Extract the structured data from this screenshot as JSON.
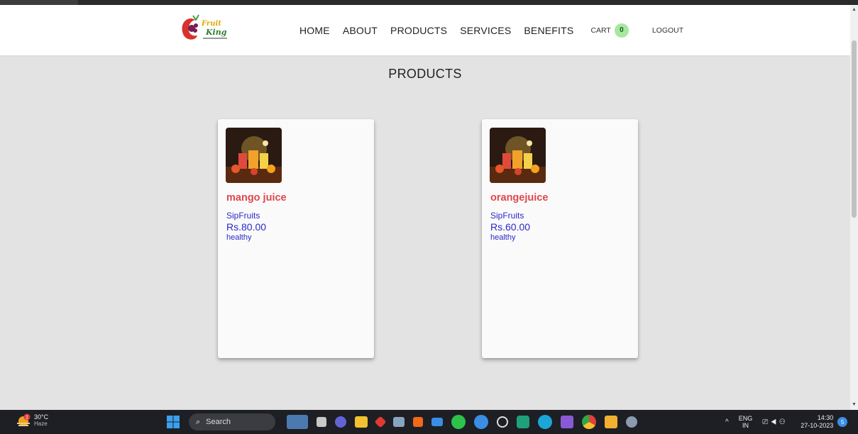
{
  "nav": {
    "logo_alt": "Fruit King",
    "links": [
      "HOME",
      "ABOUT",
      "PRODUCTS",
      "SERVICES",
      "BENEFITS"
    ],
    "cart_label": "CART",
    "cart_count": "0",
    "logout_label": "LOGOUT"
  },
  "page": {
    "title": "PRODUCTS"
  },
  "products": [
    {
      "name": "mango juice",
      "brand": "SipFruits",
      "price": "Rs.80.00",
      "tag": "healthy"
    },
    {
      "name": "orangejuice",
      "brand": "SipFruits",
      "price": "Rs.60.00",
      "tag": "healthy"
    }
  ],
  "taskbar": {
    "weather_temp": "30°C",
    "weather_cond": "Haze",
    "weather_badge": "1",
    "search_label": "Search",
    "lang_top": "ENG",
    "lang_bottom": "IN",
    "time": "14:30",
    "date": "27-10-2023",
    "notification_count": "5"
  },
  "colors": {
    "product_name": "#e0474c",
    "product_text": "#2a2ac9",
    "cart_badge": "#a6e8a0",
    "page_bg": "#e3e3e3"
  }
}
